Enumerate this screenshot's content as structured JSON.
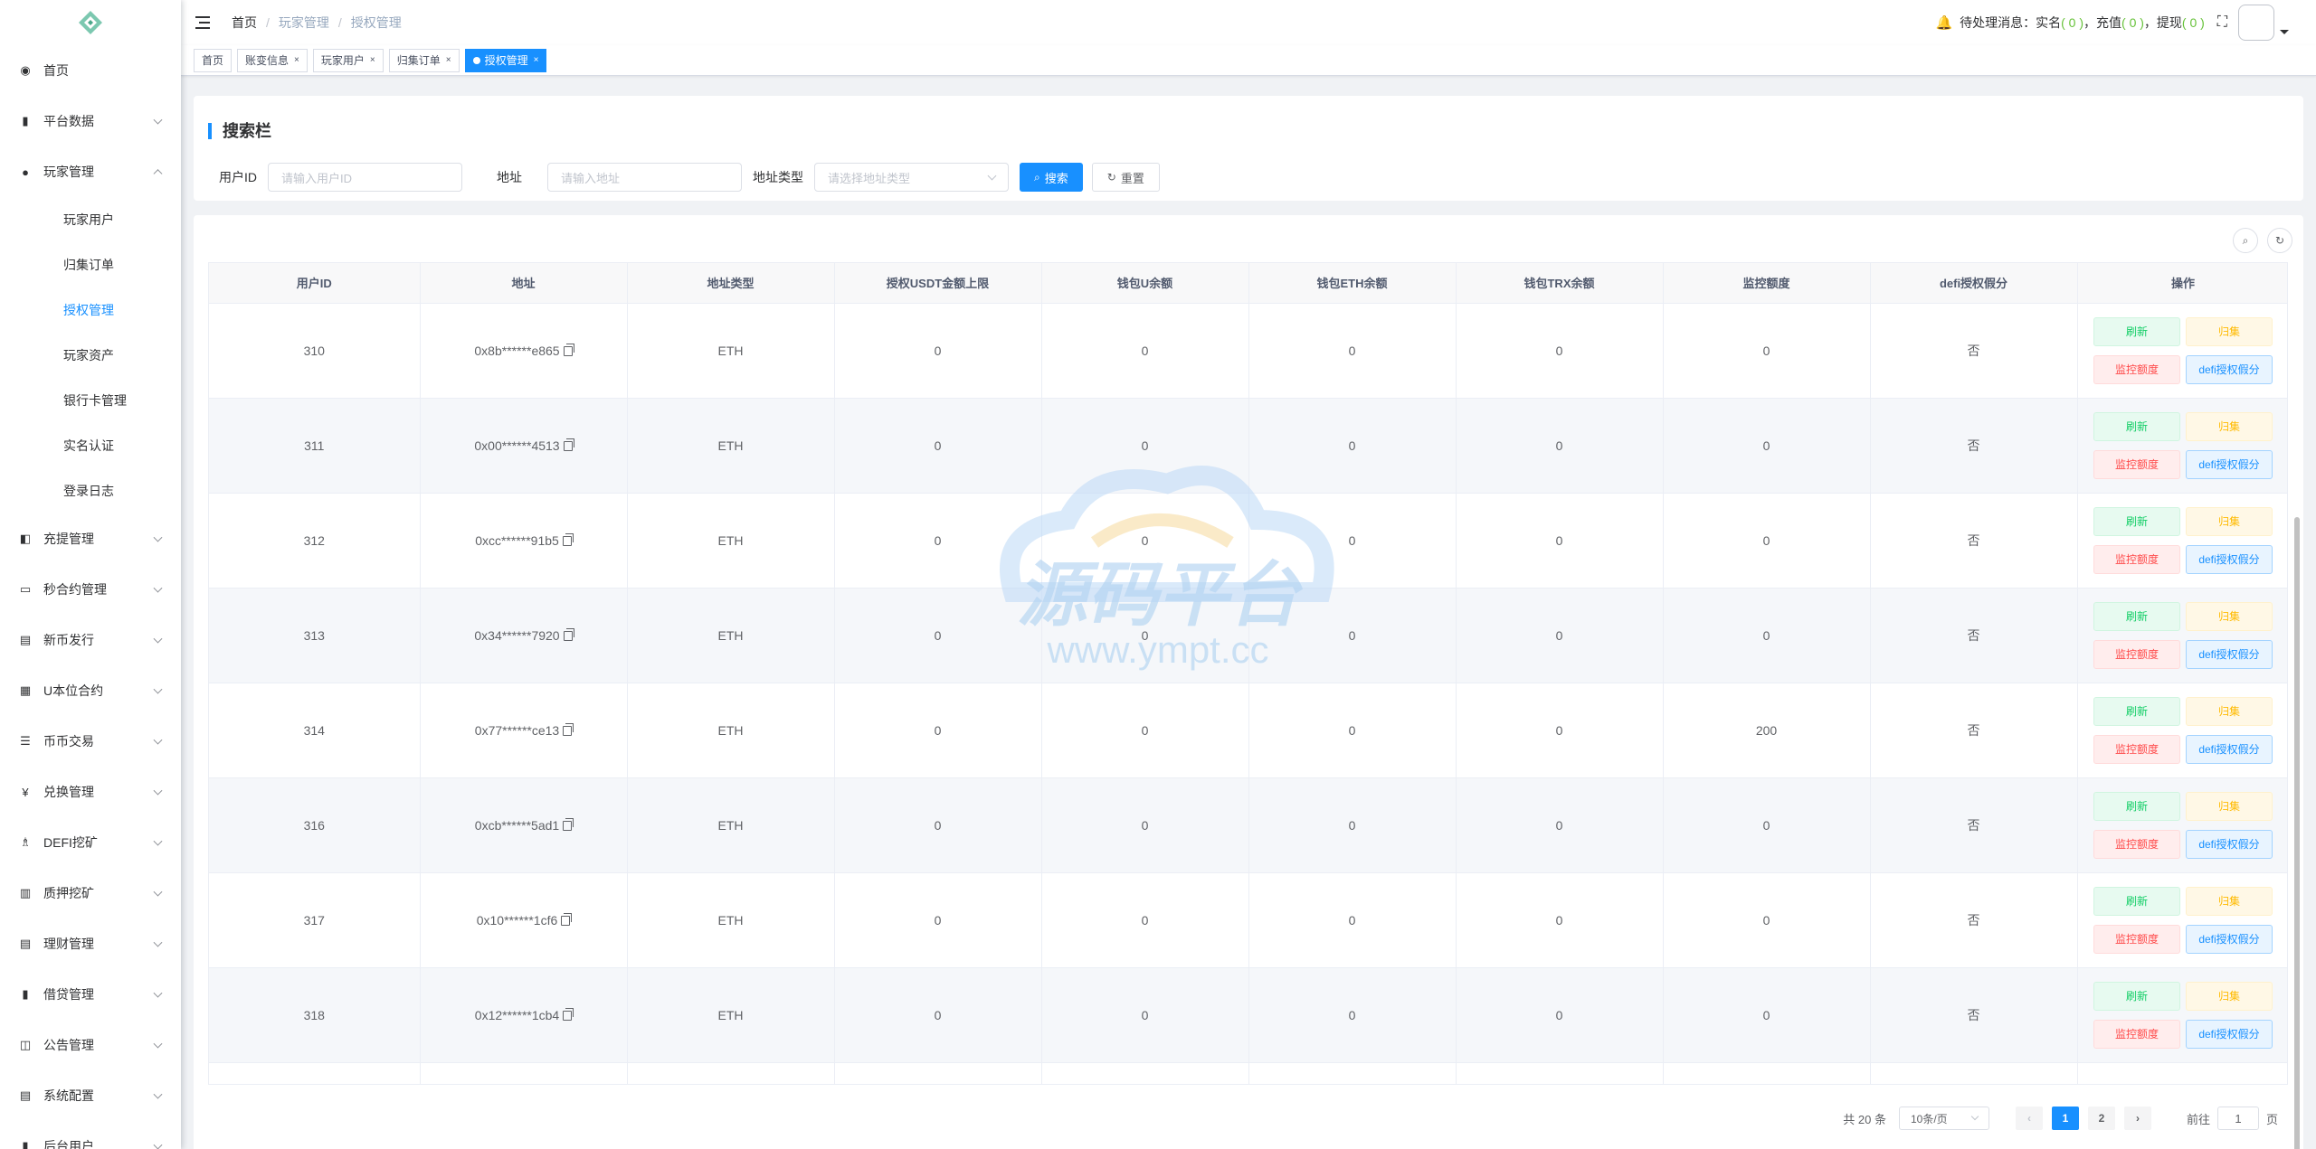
{
  "sidebar": {
    "items": [
      {
        "label": "首页",
        "icon": "dashboard-icon",
        "glyph": "◉",
        "expandable": false
      },
      {
        "label": "平台数据",
        "icon": "book-icon",
        "glyph": "▮",
        "expandable": true
      },
      {
        "label": "玩家管理",
        "icon": "user-icon",
        "glyph": "●",
        "expandable": true,
        "open": true
      },
      {
        "label": "充提管理",
        "icon": "copy-icon",
        "glyph": "◧",
        "expandable": true
      },
      {
        "label": "秒合约管理",
        "icon": "monitor-icon",
        "glyph": "▭",
        "expandable": true
      },
      {
        "label": "新币发行",
        "icon": "image-icon",
        "glyph": "▤",
        "expandable": true
      },
      {
        "label": "U本位合约",
        "icon": "grid-icon",
        "glyph": "▦",
        "expandable": true
      },
      {
        "label": "币币交易",
        "icon": "list-icon",
        "glyph": "☰",
        "expandable": true
      },
      {
        "label": "兑换管理",
        "icon": "yen-icon",
        "glyph": "¥",
        "expandable": true
      },
      {
        "label": "DEFI挖矿",
        "icon": "people-icon",
        "glyph": "♗",
        "expandable": true
      },
      {
        "label": "质押挖矿",
        "icon": "chart-icon",
        "glyph": "▥",
        "expandable": true
      },
      {
        "label": "理财管理",
        "icon": "document-icon",
        "glyph": "▤",
        "expandable": true
      },
      {
        "label": "借贷管理",
        "icon": "book-icon",
        "glyph": "▮",
        "expandable": true
      },
      {
        "label": "公告管理",
        "icon": "open-book-icon",
        "glyph": "◫",
        "expandable": true
      },
      {
        "label": "系统配置",
        "icon": "document-icon",
        "glyph": "▤",
        "expandable": true
      },
      {
        "label": "后台用户",
        "icon": "book-icon",
        "glyph": "▮",
        "expandable": true
      }
    ],
    "sub_items": [
      {
        "label": "玩家用户",
        "active": false
      },
      {
        "label": "归集订单",
        "active": false
      },
      {
        "label": "授权管理",
        "active": true
      },
      {
        "label": "玩家资产",
        "active": false
      },
      {
        "label": "银行卡管理",
        "active": false
      },
      {
        "label": "实名认证",
        "active": false
      },
      {
        "label": "登录日志",
        "active": false
      }
    ]
  },
  "header": {
    "breadcrumb": [
      "首页",
      "玩家管理",
      "授权管理"
    ],
    "pending_label": "待处理消息：",
    "realname_label": "实名",
    "realname_count": "( 0 )",
    "recharge_label": "充值",
    "recharge_count": "( 0 )",
    "withdraw_label": "提现",
    "withdraw_count": "( 0 )",
    "comma": "，"
  },
  "tags": [
    {
      "label": "首页",
      "closable": false,
      "active": false
    },
    {
      "label": "账变信息",
      "closable": true,
      "active": false
    },
    {
      "label": "玩家用户",
      "closable": true,
      "active": false
    },
    {
      "label": "归集订单",
      "closable": true,
      "active": false
    },
    {
      "label": "授权管理",
      "closable": true,
      "active": true
    }
  ],
  "search": {
    "title": "搜索栏",
    "user_id_label": "用户ID",
    "user_id_placeholder": "请输入用户ID",
    "address_label": "地址",
    "address_placeholder": "请输入地址",
    "address_type_label": "地址类型",
    "address_type_placeholder": "请选择地址类型",
    "search_button": "搜索",
    "reset_button": "重置"
  },
  "table": {
    "columns": [
      "用户ID",
      "地址",
      "地址类型",
      "授权USDT金额上限",
      "钱包U余额",
      "钱包ETH余额",
      "钱包TRX余额",
      "监控额度",
      "defi授权假分",
      "操作"
    ],
    "rows": [
      {
        "user_id": "310",
        "address": "0x8b******e865",
        "type": "ETH",
        "usdt_limit": "0",
        "u_balance": "0",
        "eth_balance": "0",
        "trx_balance": "0",
        "monitor": "0",
        "defi": "否"
      },
      {
        "user_id": "311",
        "address": "0x00******4513",
        "type": "ETH",
        "usdt_limit": "0",
        "u_balance": "0",
        "eth_balance": "0",
        "trx_balance": "0",
        "monitor": "0",
        "defi": "否"
      },
      {
        "user_id": "312",
        "address": "0xcc******91b5",
        "type": "ETH",
        "usdt_limit": "0",
        "u_balance": "0",
        "eth_balance": "0",
        "trx_balance": "0",
        "monitor": "0",
        "defi": "否"
      },
      {
        "user_id": "313",
        "address": "0x34******7920",
        "type": "ETH",
        "usdt_limit": "0",
        "u_balance": "0",
        "eth_balance": "0",
        "trx_balance": "0",
        "monitor": "0",
        "defi": "否"
      },
      {
        "user_id": "314",
        "address": "0x77******ce13",
        "type": "ETH",
        "usdt_limit": "0",
        "u_balance": "0",
        "eth_balance": "0",
        "trx_balance": "0",
        "monitor": "200",
        "defi": "否"
      },
      {
        "user_id": "316",
        "address": "0xcb******5ad1",
        "type": "ETH",
        "usdt_limit": "0",
        "u_balance": "0",
        "eth_balance": "0",
        "trx_balance": "0",
        "monitor": "0",
        "defi": "否"
      },
      {
        "user_id": "317",
        "address": "0x10******1cf6",
        "type": "ETH",
        "usdt_limit": "0",
        "u_balance": "0",
        "eth_balance": "0",
        "trx_balance": "0",
        "monitor": "0",
        "defi": "否"
      },
      {
        "user_id": "318",
        "address": "0x12******1cb4",
        "type": "ETH",
        "usdt_limit": "0",
        "u_balance": "0",
        "eth_balance": "0",
        "trx_balance": "0",
        "monitor": "0",
        "defi": "否"
      },
      {
        "user_id": "",
        "address": "",
        "type": "",
        "usdt_limit": "",
        "u_balance": "",
        "eth_balance": "",
        "trx_balance": "",
        "monitor": "",
        "defi": ""
      }
    ],
    "actions": {
      "refresh": "刷新",
      "collect": "归集",
      "monitor": "监控额度",
      "defi": "defi授权假分"
    }
  },
  "pagination": {
    "total": "共 20 条",
    "page_size": "10条/页",
    "pages": [
      "1",
      "2"
    ],
    "current": "1",
    "goto_label": "前往",
    "goto_value": "1",
    "page_unit": "页"
  },
  "watermark": {
    "title": "源码平台",
    "url": "www.ympt.cc"
  },
  "colors": {
    "primary": "#1890ff",
    "success": "#13ce66",
    "warning": "#ffba00",
    "danger": "#ff4949"
  }
}
